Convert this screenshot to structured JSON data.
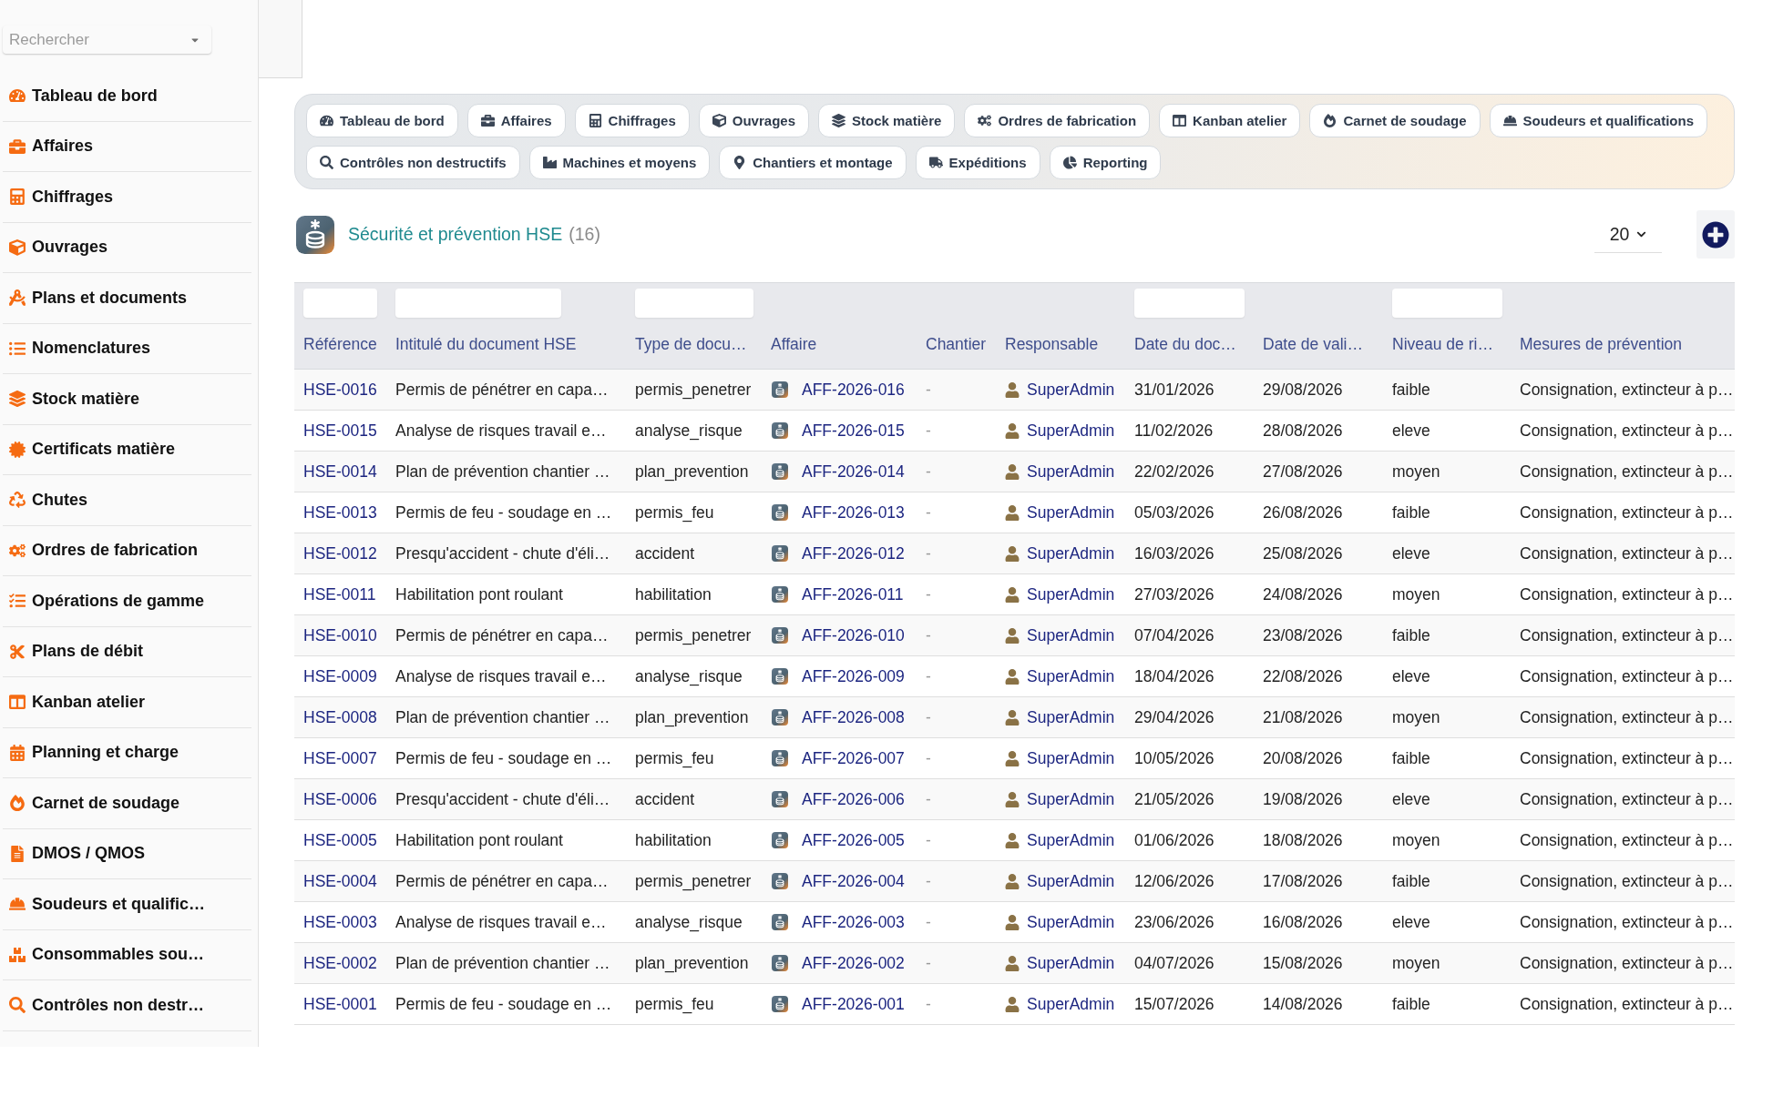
{
  "sidebar": {
    "search": {
      "placeholder": "Rechercher"
    },
    "items": [
      {
        "label": "Tableau de bord"
      },
      {
        "label": "Affaires"
      },
      {
        "label": "Chiffrages"
      },
      {
        "label": "Ouvrages"
      },
      {
        "label": "Plans et documents"
      },
      {
        "label": "Nomenclatures"
      },
      {
        "label": "Stock matière"
      },
      {
        "label": "Certificats matière"
      },
      {
        "label": "Chutes"
      },
      {
        "label": "Ordres de fabrication"
      },
      {
        "label": "Opérations de gamme"
      },
      {
        "label": "Plans de débit"
      },
      {
        "label": "Kanban atelier"
      },
      {
        "label": "Planning et charge"
      },
      {
        "label": "Carnet de soudage"
      },
      {
        "label": "DMOS / QMOS"
      },
      {
        "label": "Soudeurs et qualific…"
      },
      {
        "label": "Consommables sou…"
      },
      {
        "label": "Contrôles non destr…"
      }
    ]
  },
  "tabs": [
    {
      "label": "Tableau de bord"
    },
    {
      "label": "Affaires"
    },
    {
      "label": "Chiffrages"
    },
    {
      "label": "Ouvrages"
    },
    {
      "label": "Stock matière"
    },
    {
      "label": "Ordres de fabrication"
    },
    {
      "label": "Kanban atelier"
    },
    {
      "label": "Carnet de soudage"
    },
    {
      "label": "Soudeurs et qualifications"
    },
    {
      "label": "Contrôles non destructifs"
    },
    {
      "label": "Machines et moyens"
    },
    {
      "label": "Chantiers et montage"
    },
    {
      "label": "Expéditions"
    },
    {
      "label": "Reporting"
    }
  ],
  "section": {
    "title": "Sécurité et prévention HSE",
    "count": "(16)",
    "page_size": "20"
  },
  "table": {
    "columns": [
      {
        "label": "Référence",
        "kind": "link",
        "filter": true
      },
      {
        "label": "Intitulé du document HSE",
        "kind": "text",
        "filter": true
      },
      {
        "label": "Type de docu…",
        "kind": "text",
        "filter": true
      },
      {
        "label": "Affaire",
        "kind": "project",
        "filter": false
      },
      {
        "label": "Chantier",
        "kind": "muted",
        "filter": false
      },
      {
        "label": "Responsable",
        "kind": "user",
        "filter": false
      },
      {
        "label": "Date du doc…",
        "kind": "text",
        "filter": true
      },
      {
        "label": "Date de vali…",
        "kind": "text",
        "filter": false
      },
      {
        "label": "Niveau de ri…",
        "kind": "text",
        "filter": true
      },
      {
        "label": "Mesures de prévention",
        "kind": "text",
        "filter": false
      }
    ],
    "rows": [
      {
        "reference": "HSE-0016",
        "title": "Permis de pénétrer en capa…",
        "type": "permis_penetrer",
        "affaire": "AFF-2026-016",
        "chantier": "-",
        "responsable": "SuperAdmin",
        "date_document": "31/01/2026",
        "date_validite": "29/08/2026",
        "niveau": "faible",
        "mesures": "Consignation, extincteur à p…"
      },
      {
        "reference": "HSE-0015",
        "title": "Analyse de risques travail e…",
        "type": "analyse_risque",
        "affaire": "AFF-2026-015",
        "chantier": "-",
        "responsable": "SuperAdmin",
        "date_document": "11/02/2026",
        "date_validite": "28/08/2026",
        "niveau": "eleve",
        "mesures": "Consignation, extincteur à p…"
      },
      {
        "reference": "HSE-0014",
        "title": "Plan de prévention chantier …",
        "type": "plan_prevention",
        "affaire": "AFF-2026-014",
        "chantier": "-",
        "responsable": "SuperAdmin",
        "date_document": "22/02/2026",
        "date_validite": "27/08/2026",
        "niveau": "moyen",
        "mesures": "Consignation, extincteur à p…"
      },
      {
        "reference": "HSE-0013",
        "title": "Permis de feu - soudage en …",
        "type": "permis_feu",
        "affaire": "AFF-2026-013",
        "chantier": "-",
        "responsable": "SuperAdmin",
        "date_document": "05/03/2026",
        "date_validite": "26/08/2026",
        "niveau": "faible",
        "mesures": "Consignation, extincteur à p…"
      },
      {
        "reference": "HSE-0012",
        "title": "Presqu'accident - chute d'éli…",
        "type": "accident",
        "affaire": "AFF-2026-012",
        "chantier": "-",
        "responsable": "SuperAdmin",
        "date_document": "16/03/2026",
        "date_validite": "25/08/2026",
        "niveau": "eleve",
        "mesures": "Consignation, extincteur à p…"
      },
      {
        "reference": "HSE-0011",
        "title": "Habilitation pont roulant",
        "type": "habilitation",
        "affaire": "AFF-2026-011",
        "chantier": "-",
        "responsable": "SuperAdmin",
        "date_document": "27/03/2026",
        "date_validite": "24/08/2026",
        "niveau": "moyen",
        "mesures": "Consignation, extincteur à p…"
      },
      {
        "reference": "HSE-0010",
        "title": "Permis de pénétrer en capa…",
        "type": "permis_penetrer",
        "affaire": "AFF-2026-010",
        "chantier": "-",
        "responsable": "SuperAdmin",
        "date_document": "07/04/2026",
        "date_validite": "23/08/2026",
        "niveau": "faible",
        "mesures": "Consignation, extincteur à p…"
      },
      {
        "reference": "HSE-0009",
        "title": "Analyse de risques travail e…",
        "type": "analyse_risque",
        "affaire": "AFF-2026-009",
        "chantier": "-",
        "responsable": "SuperAdmin",
        "date_document": "18/04/2026",
        "date_validite": "22/08/2026",
        "niveau": "eleve",
        "mesures": "Consignation, extincteur à p…"
      },
      {
        "reference": "HSE-0008",
        "title": "Plan de prévention chantier …",
        "type": "plan_prevention",
        "affaire": "AFF-2026-008",
        "chantier": "-",
        "responsable": "SuperAdmin",
        "date_document": "29/04/2026",
        "date_validite": "21/08/2026",
        "niveau": "moyen",
        "mesures": "Consignation, extincteur à p…"
      },
      {
        "reference": "HSE-0007",
        "title": "Permis de feu - soudage en …",
        "type": "permis_feu",
        "affaire": "AFF-2026-007",
        "chantier": "-",
        "responsable": "SuperAdmin",
        "date_document": "10/05/2026",
        "date_validite": "20/08/2026",
        "niveau": "faible",
        "mesures": "Consignation, extincteur à p…"
      },
      {
        "reference": "HSE-0006",
        "title": "Presqu'accident - chute d'éli…",
        "type": "accident",
        "affaire": "AFF-2026-006",
        "chantier": "-",
        "responsable": "SuperAdmin",
        "date_document": "21/05/2026",
        "date_validite": "19/08/2026",
        "niveau": "eleve",
        "mesures": "Consignation, extincteur à p…"
      },
      {
        "reference": "HSE-0005",
        "title": "Habilitation pont roulant",
        "type": "habilitation",
        "affaire": "AFF-2026-005",
        "chantier": "-",
        "responsable": "SuperAdmin",
        "date_document": "01/06/2026",
        "date_validite": "18/08/2026",
        "niveau": "moyen",
        "mesures": "Consignation, extincteur à p…"
      },
      {
        "reference": "HSE-0004",
        "title": "Permis de pénétrer en capa…",
        "type": "permis_penetrer",
        "affaire": "AFF-2026-004",
        "chantier": "-",
        "responsable": "SuperAdmin",
        "date_document": "12/06/2026",
        "date_validite": "17/08/2026",
        "niveau": "faible",
        "mesures": "Consignation, extincteur à p…"
      },
      {
        "reference": "HSE-0003",
        "title": "Analyse de risques travail e…",
        "type": "analyse_risque",
        "affaire": "AFF-2026-003",
        "chantier": "-",
        "responsable": "SuperAdmin",
        "date_document": "23/06/2026",
        "date_validite": "16/08/2026",
        "niveau": "eleve",
        "mesures": "Consignation, extincteur à p…"
      },
      {
        "reference": "HSE-0002",
        "title": "Plan de prévention chantier …",
        "type": "plan_prevention",
        "affaire": "AFF-2026-002",
        "chantier": "-",
        "responsable": "SuperAdmin",
        "date_document": "04/07/2026",
        "date_validite": "15/08/2026",
        "niveau": "moyen",
        "mesures": "Consignation, extincteur à p…"
      },
      {
        "reference": "HSE-0001",
        "title": "Permis de feu - soudage en …",
        "type": "permis_feu",
        "affaire": "AFF-2026-001",
        "chantier": "-",
        "responsable": "SuperAdmin",
        "date_document": "15/07/2026",
        "date_validite": "14/08/2026",
        "niveau": "faible",
        "mesures": "Consignation, extincteur à p…"
      }
    ]
  }
}
